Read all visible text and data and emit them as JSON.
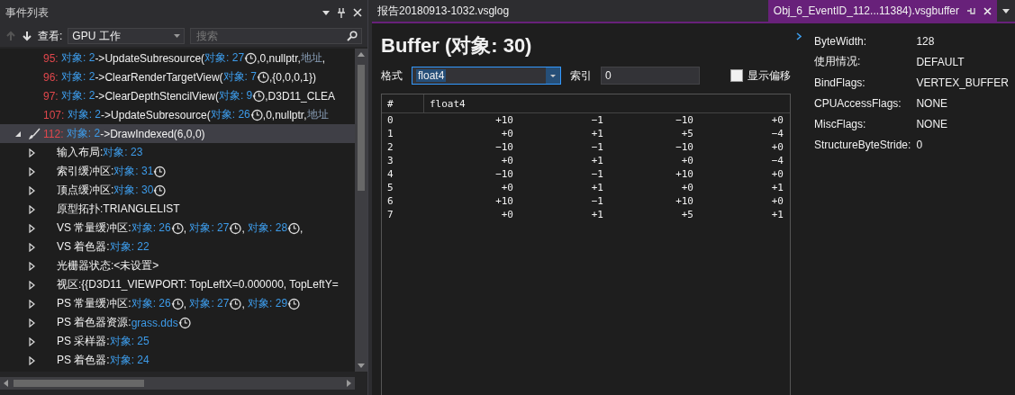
{
  "event_list": {
    "title": "事件列表",
    "toolbar": {
      "view_label": "查看:",
      "view_value": "GPU 工作",
      "search_placeholder": "搜索"
    },
    "items": [
      {
        "kind": "call",
        "selected": false,
        "parts": [
          {
            "kind": "id",
            "text": "95:"
          },
          {
            "kind": "link",
            "text": " 对象: 2"
          },
          {
            "kind": "text",
            "text": "->UpdateSubresource("
          },
          {
            "kind": "link",
            "text": "对象: 27"
          },
          {
            "kind": "clock"
          },
          {
            "kind": "text",
            "text": ",0,nullptr,"
          },
          {
            "kind": "dim",
            "text": "地址"
          },
          {
            "kind": "text",
            "text": ","
          }
        ]
      },
      {
        "kind": "call",
        "selected": false,
        "parts": [
          {
            "kind": "id",
            "text": "96:"
          },
          {
            "kind": "link",
            "text": " 对象: 2"
          },
          {
            "kind": "text",
            "text": "->ClearRenderTargetView("
          },
          {
            "kind": "link",
            "text": "对象: 7"
          },
          {
            "kind": "clock"
          },
          {
            "kind": "text",
            "text": ",{0,0,0,1})"
          }
        ]
      },
      {
        "kind": "call",
        "selected": false,
        "parts": [
          {
            "kind": "id",
            "text": "97:"
          },
          {
            "kind": "link",
            "text": " 对象: 2"
          },
          {
            "kind": "text",
            "text": "->ClearDepthStencilView("
          },
          {
            "kind": "link",
            "text": "对象: 9"
          },
          {
            "kind": "clock"
          },
          {
            "kind": "text",
            "text": ",D3D11_CLEA"
          }
        ]
      },
      {
        "kind": "call",
        "selected": false,
        "parts": [
          {
            "kind": "id",
            "text": "107:"
          },
          {
            "kind": "link",
            "text": " 对象: 2"
          },
          {
            "kind": "text",
            "text": "->UpdateSubresource("
          },
          {
            "kind": "link",
            "text": "对象: 26"
          },
          {
            "kind": "clock"
          },
          {
            "kind": "text",
            "text": ",0,nullptr,"
          },
          {
            "kind": "dim",
            "text": "地址"
          }
        ]
      },
      {
        "kind": "draw",
        "selected": true,
        "expanded": true,
        "parts": [
          {
            "kind": "id",
            "text": "112:"
          },
          {
            "kind": "link",
            "text": " 对象: 2"
          },
          {
            "kind": "text",
            "text": "->DrawIndexed(6,0,0)"
          }
        ],
        "children": [
          {
            "selected": false,
            "expanded": false,
            "parts": [
              {
                "kind": "text",
                "text": "输入布局:"
              },
              {
                "kind": "link",
                "text": "对象: 23"
              }
            ]
          },
          {
            "selected": false,
            "expanded": false,
            "parts": [
              {
                "kind": "text",
                "text": "索引缓冲区:"
              },
              {
                "kind": "link",
                "text": "对象: 31"
              },
              {
                "kind": "clock"
              }
            ]
          },
          {
            "selected": false,
            "expanded": false,
            "parts": [
              {
                "kind": "text",
                "text": "顶点缓冲区:"
              },
              {
                "kind": "link",
                "text": "对象: 30"
              },
              {
                "kind": "clock"
              }
            ]
          },
          {
            "selected": false,
            "expanded": false,
            "parts": [
              {
                "kind": "text",
                "text": "原型拓扑:TRIANGLELIST"
              }
            ]
          },
          {
            "selected": false,
            "expanded": false,
            "parts": [
              {
                "kind": "text",
                "text": "VS 常量缓冲区:"
              },
              {
                "kind": "link",
                "text": "对象: 26"
              },
              {
                "kind": "clock"
              },
              {
                "kind": "text",
                "text": ", "
              },
              {
                "kind": "link",
                "text": "对象: 27"
              },
              {
                "kind": "clock"
              },
              {
                "kind": "text",
                "text": ", "
              },
              {
                "kind": "link",
                "text": "对象: 28"
              },
              {
                "kind": "clock"
              },
              {
                "kind": "text",
                "text": ","
              }
            ]
          },
          {
            "selected": false,
            "expanded": false,
            "parts": [
              {
                "kind": "text",
                "text": "VS 着色器:"
              },
              {
                "kind": "link",
                "text": "对象: 22"
              }
            ]
          },
          {
            "selected": false,
            "expanded": false,
            "parts": [
              {
                "kind": "text",
                "text": "光栅器状态:<未设置>"
              }
            ]
          },
          {
            "selected": false,
            "expanded": false,
            "parts": [
              {
                "kind": "text",
                "text": "视区:{{D3D11_VIEWPORT: TopLeftX=0.000000, TopLeftY="
              }
            ]
          },
          {
            "selected": false,
            "expanded": false,
            "parts": [
              {
                "kind": "text",
                "text": "PS 常量缓冲区:"
              },
              {
                "kind": "link",
                "text": "对象: 26"
              },
              {
                "kind": "clock"
              },
              {
                "kind": "text",
                "text": ", "
              },
              {
                "kind": "link",
                "text": "对象: 27"
              },
              {
                "kind": "clock"
              },
              {
                "kind": "text",
                "text": ", "
              },
              {
                "kind": "link",
                "text": "对象: 29"
              },
              {
                "kind": "clock"
              }
            ]
          },
          {
            "selected": false,
            "expanded": false,
            "parts": [
              {
                "kind": "text",
                "text": "PS 着色器资源:"
              },
              {
                "kind": "link",
                "text": "grass.dds"
              },
              {
                "kind": "clock"
              }
            ]
          },
          {
            "selected": false,
            "expanded": false,
            "parts": [
              {
                "kind": "text",
                "text": "PS 采样器:"
              },
              {
                "kind": "link",
                "text": "对象: 25"
              }
            ]
          },
          {
            "selected": false,
            "expanded": false,
            "parts": [
              {
                "kind": "text",
                "text": "PS 着色器:"
              },
              {
                "kind": "link",
                "text": "对象: 24"
              }
            ]
          }
        ]
      }
    ]
  },
  "document_tabs": [
    {
      "label": "报告20180913-1032.vsglog",
      "selected": false
    },
    {
      "label": "Obj_6_EventID_112...11384).vsgbuffer",
      "selected": true
    }
  ],
  "buffer": {
    "title": "Buffer (对象: 30)",
    "format_label": "格式",
    "format_value": "float4",
    "index_label": "索引",
    "index_value": "0",
    "show_offset": {
      "label": "显示偏移",
      "checked": false
    },
    "table": {
      "columns": [
        "#",
        "float4"
      ],
      "rows": [
        {
          "index": "0",
          "values": [
            "+10",
            "−1",
            "−10",
            "+0"
          ]
        },
        {
          "index": "1",
          "values": [
            "+0",
            "+1",
            "+5",
            "−4"
          ]
        },
        {
          "index": "2",
          "values": [
            "−10",
            "−1",
            "−10",
            "+0"
          ]
        },
        {
          "index": "3",
          "values": [
            "+0",
            "+1",
            "+0",
            "−4"
          ]
        },
        {
          "index": "4",
          "values": [
            "−10",
            "−1",
            "+10",
            "+0"
          ]
        },
        {
          "index": "5",
          "values": [
            "+0",
            "+1",
            "+0",
            "+1"
          ]
        },
        {
          "index": "6",
          "values": [
            "+10",
            "−1",
            "+10",
            "+0"
          ]
        },
        {
          "index": "7",
          "values": [
            "+0",
            "+1",
            "+5",
            "+1"
          ]
        }
      ]
    }
  },
  "properties": [
    {
      "label": "ByteWidth:",
      "value": "128"
    },
    {
      "label": "使用情况:",
      "value": "DEFAULT"
    },
    {
      "label": "BindFlags:",
      "value": "VERTEX_BUFFER"
    },
    {
      "label": "CPUAccessFlags:",
      "value": "NONE"
    },
    {
      "label": "MiscFlags:",
      "value": "NONE"
    },
    {
      "label": "StructureByteStride:",
      "value": "0"
    }
  ]
}
